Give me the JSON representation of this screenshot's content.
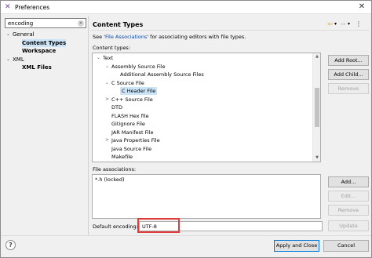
{
  "window": {
    "title": "Preferences",
    "close_glyph": "✕"
  },
  "filter": {
    "value": "encoding",
    "clear_glyph": "×"
  },
  "left_tree": [
    {
      "label": "General",
      "arrow": "⌄",
      "selected": false,
      "bold": false
    },
    {
      "label": "Content Types",
      "arrow": "",
      "selected": true,
      "bold": true
    },
    {
      "label": "Workspace",
      "arrow": "",
      "selected": false,
      "bold": true
    },
    {
      "label": "XML",
      "arrow": "⌄",
      "selected": false,
      "bold": false
    },
    {
      "label": "XML Files",
      "arrow": "",
      "selected": false,
      "bold": true
    }
  ],
  "page": {
    "title": "Content Types",
    "nav": {
      "back": "⇦",
      "back_menu": "▾",
      "forward": "⇨",
      "forward_menu": "▾",
      "menu": "⋮"
    },
    "description_prefix": "See '",
    "description_link": "File Associations",
    "description_suffix": "' for associating editors with file types.",
    "content_types_label": "Content types:",
    "content_types": [
      {
        "label": "Text",
        "arrow": "⌄",
        "selected": false
      },
      {
        "label": "Assembly Source File",
        "arrow": "⌄",
        "selected": false
      },
      {
        "label": "Additional Assembly Source Files",
        "arrow": "",
        "selected": false
      },
      {
        "label": "C Source File",
        "arrow": "⌄",
        "selected": false
      },
      {
        "label": "C Header File",
        "arrow": "",
        "selected": true
      },
      {
        "label": "C++ Source File",
        "arrow": ">",
        "selected": false
      },
      {
        "label": "DTD",
        "arrow": "",
        "selected": false
      },
      {
        "label": "FLASH Hex file",
        "arrow": "",
        "selected": false
      },
      {
        "label": "Gitignore File",
        "arrow": "",
        "selected": false
      },
      {
        "label": "JAR Manifest File",
        "arrow": "",
        "selected": false
      },
      {
        "label": "Java Properties File",
        "arrow": ">",
        "selected": false
      },
      {
        "label": "Java Source File",
        "arrow": "",
        "selected": false
      },
      {
        "label": "Makefile",
        "arrow": "",
        "selected": false
      }
    ],
    "buttons_top": {
      "add_root": "Add Root...",
      "add_child": "Add Child...",
      "remove": "Remove"
    },
    "file_associations_label": "File associations:",
    "file_associations": [
      "*.h (locked)"
    ],
    "buttons_fa": {
      "add": "Add...",
      "edit": "Edit...",
      "remove": "Remove"
    },
    "default_encoding_label": "Default encoding:",
    "default_encoding_value": "UTF-8",
    "update": "Update"
  },
  "footer": {
    "help": "?",
    "apply_close": "Apply and Close",
    "cancel": "Cancel"
  },
  "colors": {
    "selection": "#cce4f7",
    "highlight_box": "#e03c3c",
    "link": "#0645ad"
  }
}
